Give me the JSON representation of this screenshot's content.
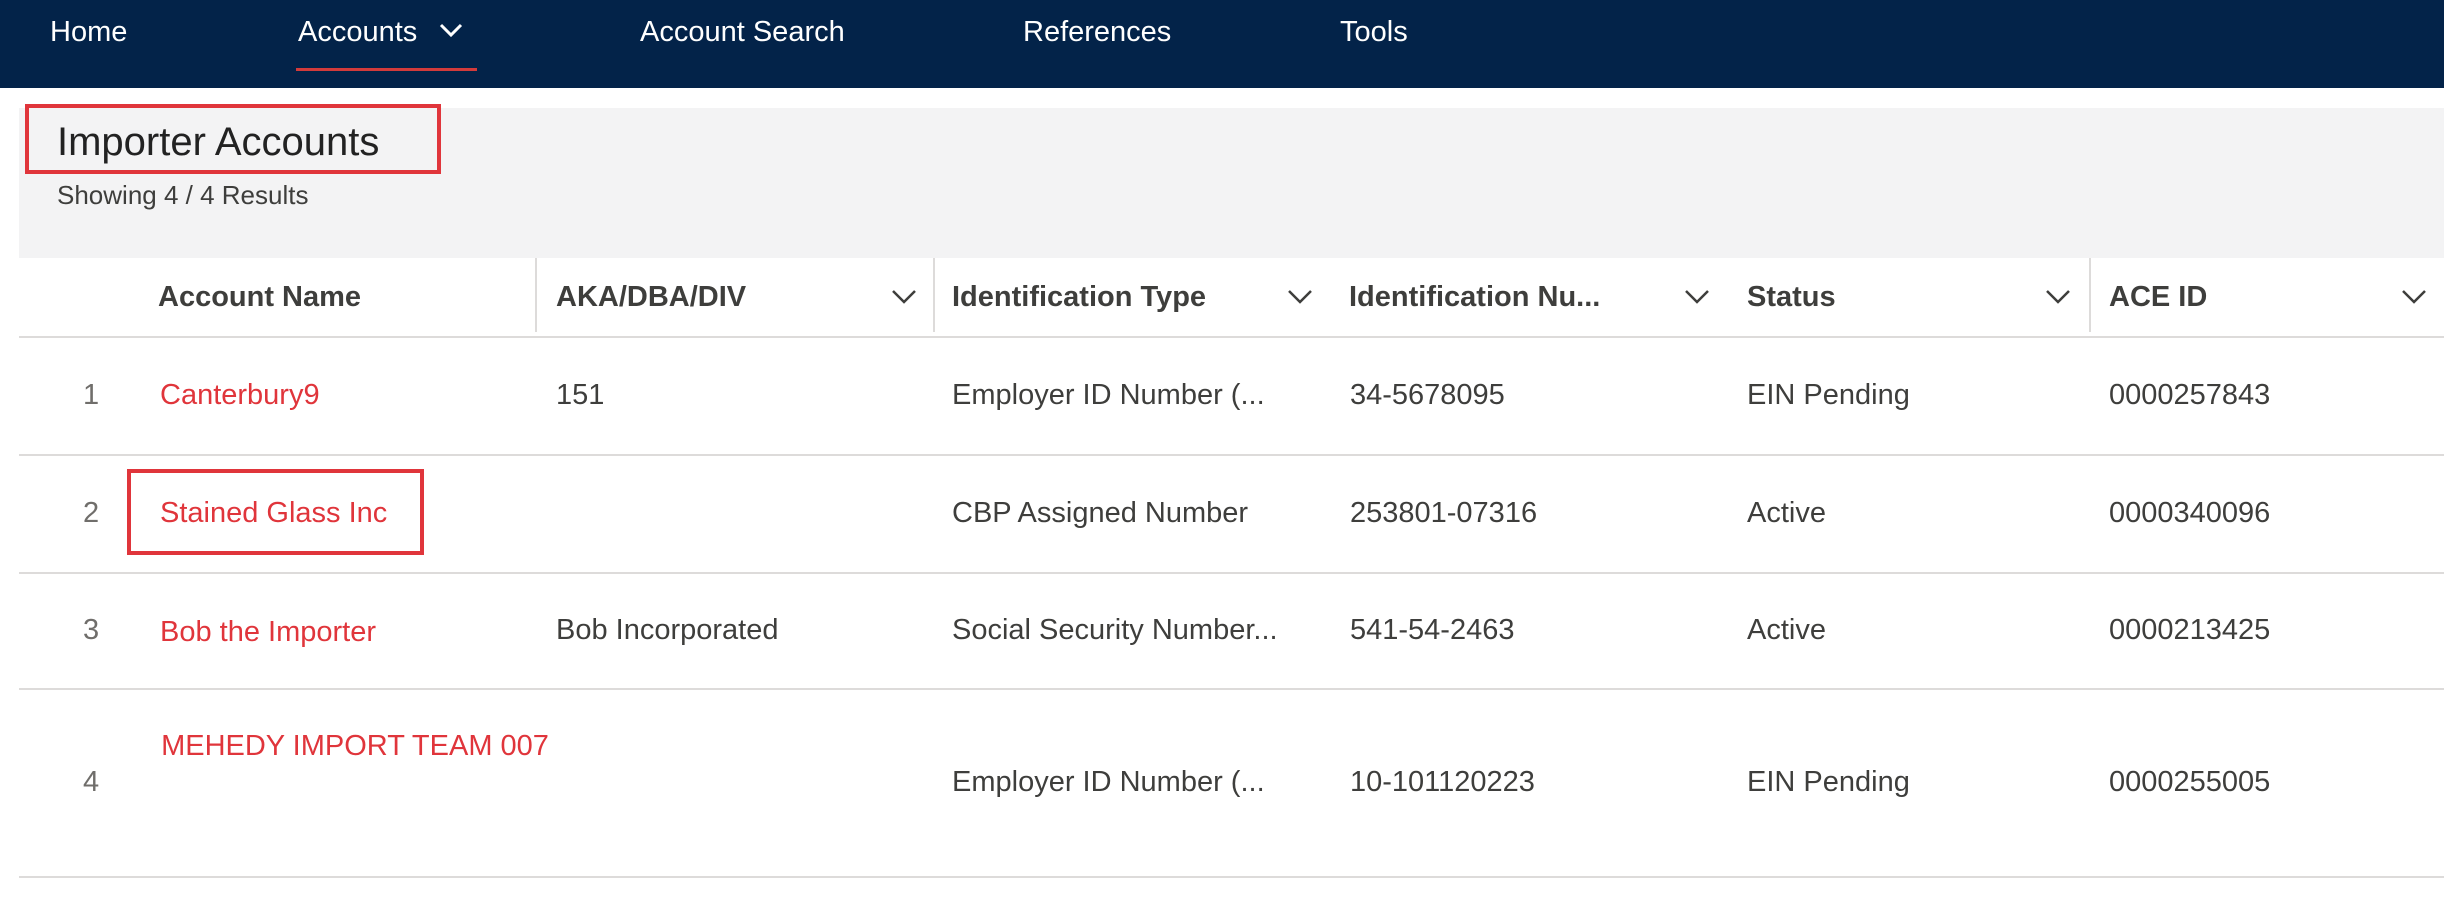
{
  "nav": {
    "items": [
      {
        "label": "Home"
      },
      {
        "label": "Accounts",
        "active": true
      },
      {
        "label": "Account Search"
      },
      {
        "label": "References"
      },
      {
        "label": "Tools"
      }
    ]
  },
  "header": {
    "title": "Importer Accounts",
    "result_count": "Showing 4 / 4 Results"
  },
  "table": {
    "columns": [
      {
        "label": "Account Name"
      },
      {
        "label": "AKA/DBA/DIV"
      },
      {
        "label": "Identification Type"
      },
      {
        "label": "Identification Nu..."
      },
      {
        "label": "Status"
      },
      {
        "label": "ACE ID"
      }
    ],
    "rows": [
      {
        "num": "1",
        "name": "Canterbury9",
        "aka": "151",
        "id_type": "Employer ID Number (...",
        "id_number": "34-5678095",
        "status": "EIN Pending",
        "ace_id": "0000257843"
      },
      {
        "num": "2",
        "name": "Stained Glass Inc",
        "aka": "",
        "id_type": "CBP Assigned Number",
        "id_number": "253801-07316",
        "status": "Active",
        "ace_id": "0000340096"
      },
      {
        "num": "3",
        "name": "Bob the Importer",
        "aka": "Bob Incorporated",
        "id_type": "Social Security Number...",
        "id_number": "541-54-2463",
        "status": "Active",
        "ace_id": "0000213425"
      },
      {
        "num": "4",
        "name": "MEHEDY IMPORT TEAM 007",
        "aka": "",
        "id_type": "Employer ID Number (...",
        "id_number": "10-101120223",
        "status": "EIN Pending",
        "ace_id": "0000255005"
      }
    ]
  },
  "colors": {
    "nav_bg": "#032349",
    "link": "#e0353b",
    "highlight_box": "#e0353b",
    "header_bg": "#f3f3f4"
  },
  "icons": {
    "dropdown": "chevron-down-icon"
  }
}
